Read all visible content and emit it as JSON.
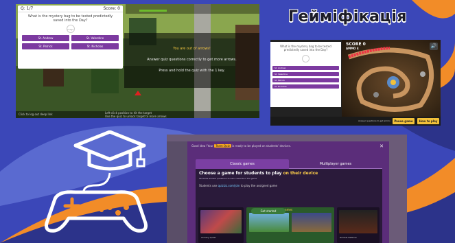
{
  "title": "Гейміфікація",
  "colors": {
    "background": "#3b47b8",
    "accent_orange": "#f28c28",
    "accent_purple": "#7c3aa0",
    "yellow": "#f3c13a"
  },
  "shot1": {
    "counter": "Q: 1/7",
    "score": "Score: 0",
    "question": "What is the mystery bag to be tested predictedly saved into the Day?",
    "image_label": "image",
    "answers": [
      "St. Andrew",
      "St. Valentine",
      "St. Patrick",
      "St. Nicholas"
    ],
    "overlay": {
      "title": "You are out of arrows!",
      "line1": "Answer quiz questions correctly to get more arrows.",
      "line2": "Press and hold the quiz with the 1 key."
    },
    "bottom_left": "Click to log out deep link",
    "bottom_mid1": "Left-click position to hit the target",
    "bottom_mid2": "Use the quiz to unlock target to more arrows"
  },
  "shot2": {
    "question": "What is the mystery bag to be tested predictedly saved into the Day?",
    "answers": [
      "St. Andrew",
      "St. Valentine",
      "St. Patrick",
      "St. Nicholas"
    ],
    "score": "SCORE 0",
    "ammo": "AMMO 4",
    "speaker_icon": "🔊",
    "footer_label": "Answer questions to get ammo",
    "pause_label": "Pause game",
    "howto_label": "How to play"
  },
  "shot3": {
    "top_text_pre": "Good idea! Your",
    "top_badge": "Team Quiz",
    "top_text_post": "is ready to be played on students' devices.",
    "close": "✕",
    "tab1": "Classic games",
    "tab2": "Multiplayer games",
    "heading_pre": "Choose a game for students to play",
    "heading_hl": "on their device",
    "sub": "Students answer questions to earn rewards in the game",
    "line2_pre": "Students use",
    "line2_hl": "quizizz.com/join",
    "line2_post": "to play the assigned game",
    "card1_caption": "Archery Quest",
    "card2_title": "Multiplayer games",
    "card3_caption": "Zombie Defense",
    "play_button": "Get started"
  }
}
